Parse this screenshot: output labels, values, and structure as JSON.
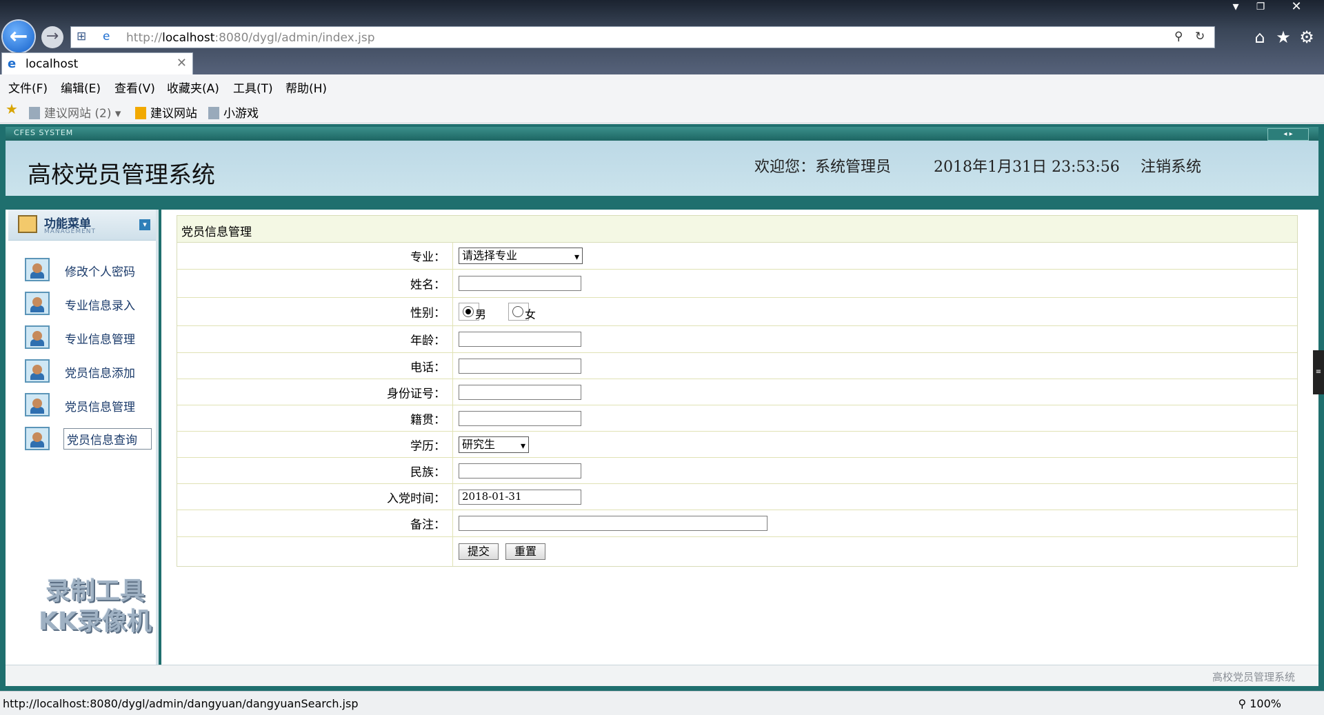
{
  "browser": {
    "address": {
      "prefix": "http://",
      "host": "localhost",
      "rest": ":8080/dygl/admin/index.jsp"
    },
    "tab": {
      "title": "localhost"
    },
    "menu": [
      "文件(F)",
      "编辑(E)",
      "查看(V)",
      "收藏夹(A)",
      "工具(T)",
      "帮助(H)"
    ],
    "favorites": [
      "建议网站 (2)",
      "建议网站",
      "小游戏"
    ],
    "status_url": "http://localhost:8080/dygl/admin/dangyuan/dangyuanSearch.jsp",
    "zoom": "100%"
  },
  "app": {
    "strip_logo": "CFES SYSTEM",
    "title": "高校党员管理系统",
    "welcome": "欢迎您：系统管理员",
    "datetime": "2018年1月31日 23:53:56",
    "logout": "注销系统",
    "footer": "高校党员管理系统",
    "watermark_line1": "录制工具",
    "watermark_line2": "KK录像机"
  },
  "sidebar": {
    "title": "功能菜单",
    "subtitle": "MANAGEMENT",
    "items": [
      {
        "label": "修改个人密码"
      },
      {
        "label": "专业信息录入"
      },
      {
        "label": "专业信息管理"
      },
      {
        "label": "党员信息添加"
      },
      {
        "label": "党员信息管理"
      },
      {
        "label": "党员信息查询"
      }
    ]
  },
  "form": {
    "panel_title": "党员信息管理",
    "labels": {
      "major": "专业：",
      "name": "姓名：",
      "gender": "性别：",
      "age": "年龄：",
      "phone": "电话：",
      "id_number": "身份证号：",
      "hometown": "籍贯：",
      "education": "学历：",
      "ethnicity": "民族：",
      "join_date": "入党时间：",
      "remark": "备注："
    },
    "major_selected": "请选择专业",
    "gender_male": "男",
    "gender_female": "女",
    "education_selected": "研究生",
    "join_date_value": "2018-01-31",
    "submit": "提交",
    "reset": "重置"
  }
}
